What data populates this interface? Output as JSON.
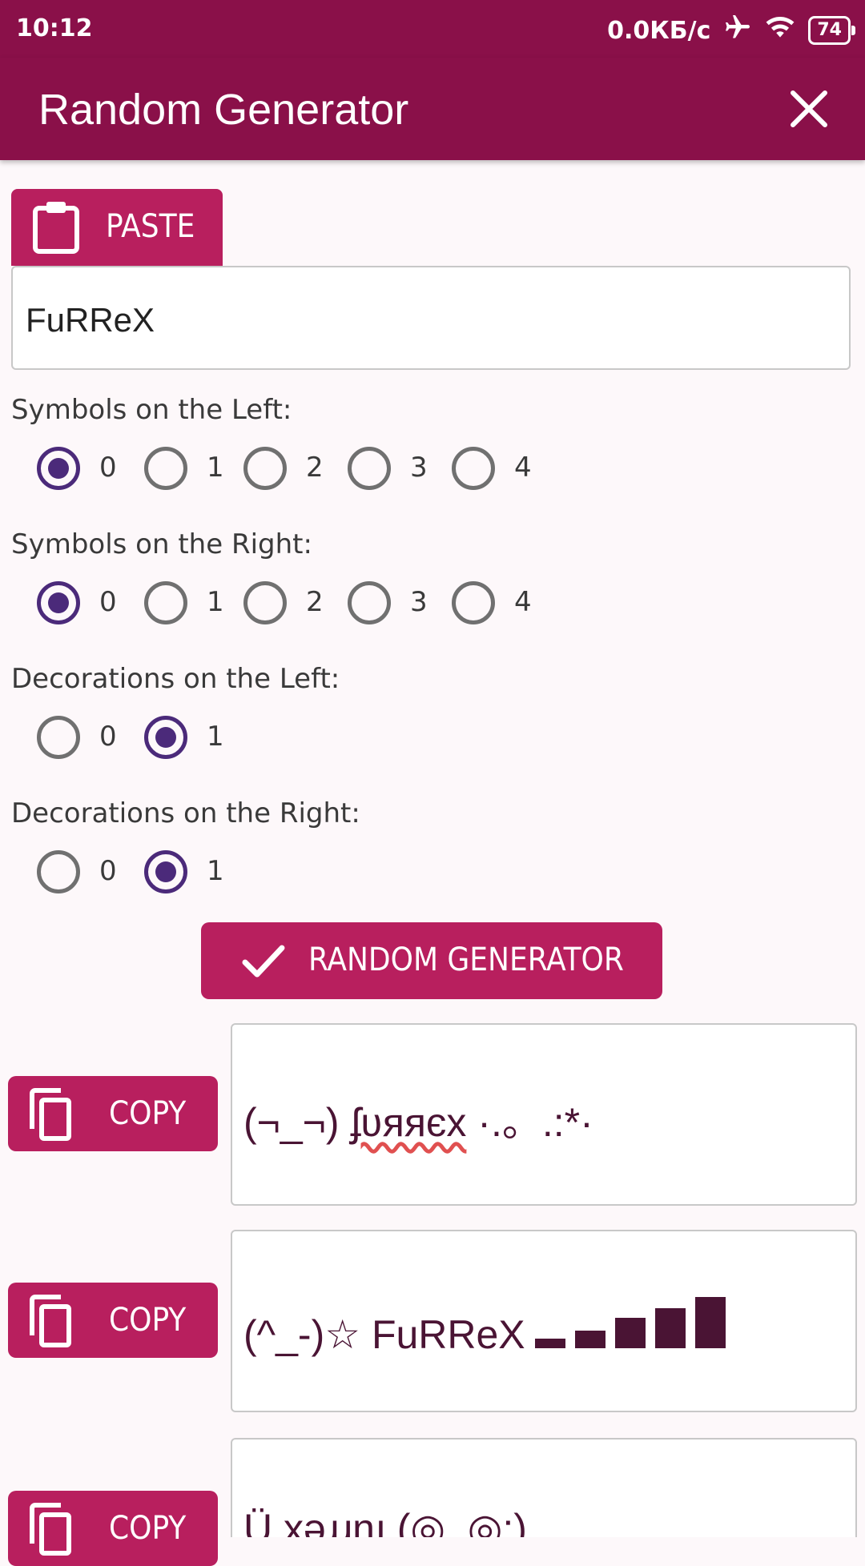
{
  "status_bar": {
    "time": "10:12",
    "network_speed": "0.0КБ/с",
    "battery": "74"
  },
  "app_bar": {
    "title": "Random Generator",
    "close_icon": "close-icon"
  },
  "paste_button": {
    "label": "PASTE",
    "icon": "clipboard-icon"
  },
  "input": {
    "value": "FuRReX"
  },
  "groups": [
    {
      "label": "Symbols on the Left:",
      "options": [
        "0",
        "1",
        "2",
        "3",
        "4"
      ],
      "selected": "0"
    },
    {
      "label": "Symbols on the Right:",
      "options": [
        "0",
        "1",
        "2",
        "3",
        "4"
      ],
      "selected": "0"
    },
    {
      "label": "Decorations on the Left:",
      "options": [
        "0",
        "1"
      ],
      "selected": "1"
    },
    {
      "label": "Decorations on the Right:",
      "options": [
        "0",
        "1"
      ],
      "selected": "1"
    }
  ],
  "generate_button": {
    "label": "RANDOM GENERATOR",
    "icon": "check-icon"
  },
  "results": [
    {
      "copy_label": "COPY",
      "prefix": "(¬_¬) ",
      "name": "ʄʋяяєx",
      "suffix": " ·.。.:*·"
    },
    {
      "copy_label": "COPY",
      "prefix": "(^_-)☆ ",
      "name": "FuRReX",
      "suffix": ""
    },
    {
      "copy_label": "COPY",
      "prefix": "Ü ",
      "name": "xǝɹɹnɟ",
      "suffix": " (◎_◎;)"
    }
  ],
  "colors": {
    "primary": "#8a1049",
    "button": "#b81f5e",
    "radio_checked": "#4b2a7a",
    "result_text": "#4a1434"
  }
}
